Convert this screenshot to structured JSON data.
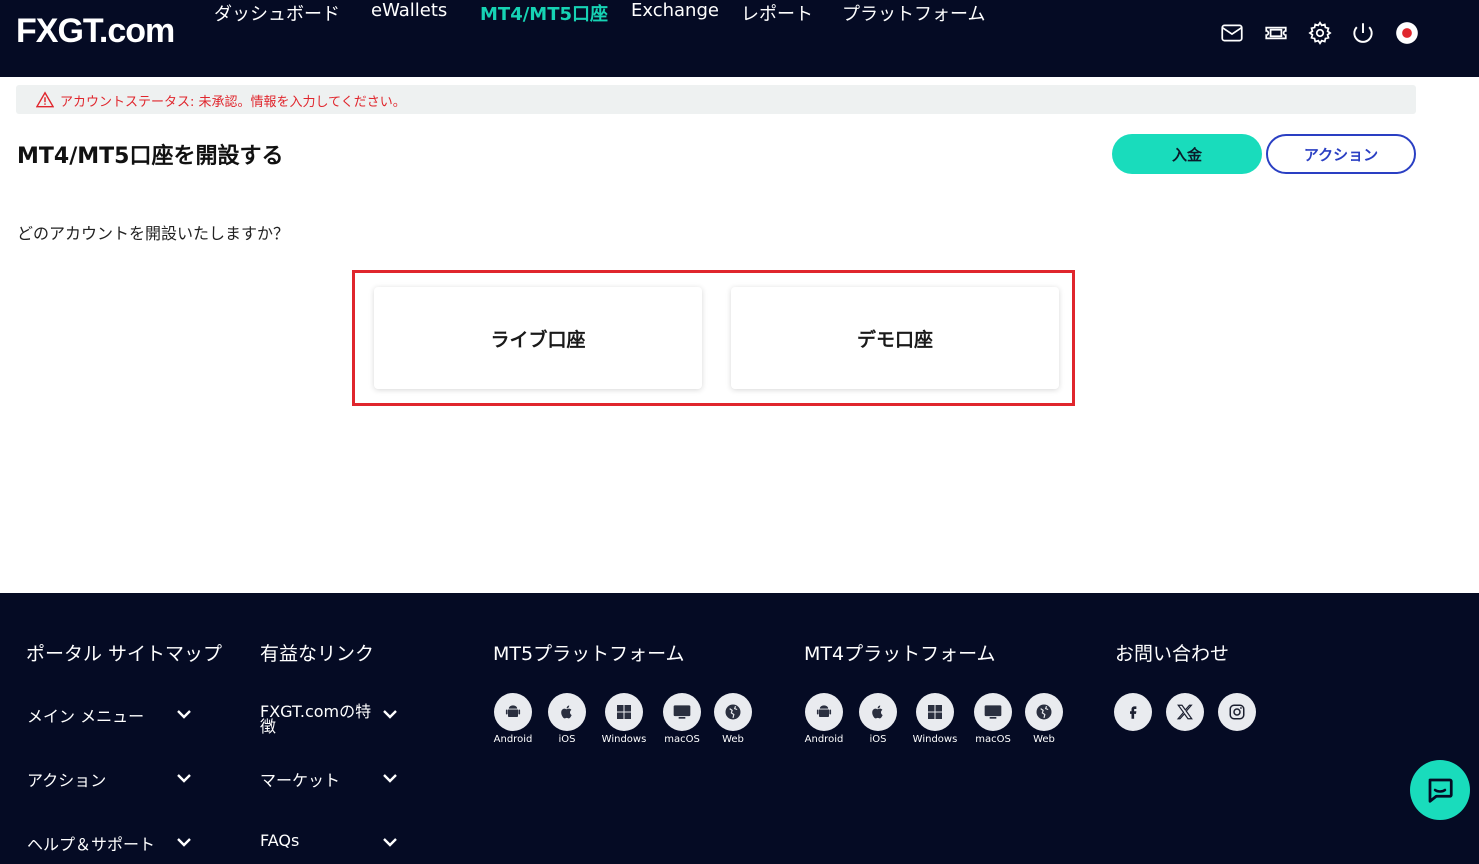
{
  "header": {
    "logo": "FXGT.com",
    "nav": [
      {
        "label": "ダッシュボード"
      },
      {
        "label": "eWallets"
      },
      {
        "label": "MT4/MT5口座"
      },
      {
        "label": "Exchange"
      },
      {
        "label": "レポート"
      },
      {
        "label": "プラットフォーム"
      }
    ],
    "active_nav": "MT4/MT5口座",
    "icons": [
      "mail-icon",
      "ticket-icon",
      "gear-icon",
      "power-icon",
      "japan-flag-icon"
    ]
  },
  "alert": {
    "text": "アカウントステータス: 未承認。情報を入力してください。"
  },
  "page": {
    "title": "MT4/MT5口座を開設する",
    "deposit_label": "入金",
    "action_label": "アクション",
    "question": "どのアカウントを開設いたしますか？",
    "cards": [
      {
        "label": "ライブ口座"
      },
      {
        "label": "デモ口座"
      }
    ]
  },
  "footer": {
    "columns": [
      {
        "heading": "ポータル サイトマップ",
        "links": [
          "メイン メニュー",
          "アクション",
          "ヘルプ＆サポート"
        ]
      },
      {
        "heading": "有益なリンク",
        "links": [
          "FXGT.comの特徴",
          "マーケット",
          "FAQs"
        ]
      },
      {
        "heading": "MT5プラットフォーム",
        "platforms": [
          "Android",
          "iOS",
          "Windows",
          "macOS",
          "Web"
        ]
      },
      {
        "heading": "MT4プラットフォーム",
        "platforms": [
          "Android",
          "iOS",
          "Windows",
          "macOS",
          "Web"
        ]
      },
      {
        "heading": "お問い合わせ",
        "socials": [
          "facebook-icon",
          "x-icon",
          "instagram-icon"
        ]
      }
    ]
  },
  "colors": {
    "header_bg": "#050b24",
    "accent": "#19dcbc",
    "alert_red": "#e0262d",
    "action_blue": "#2a3fc3"
  }
}
